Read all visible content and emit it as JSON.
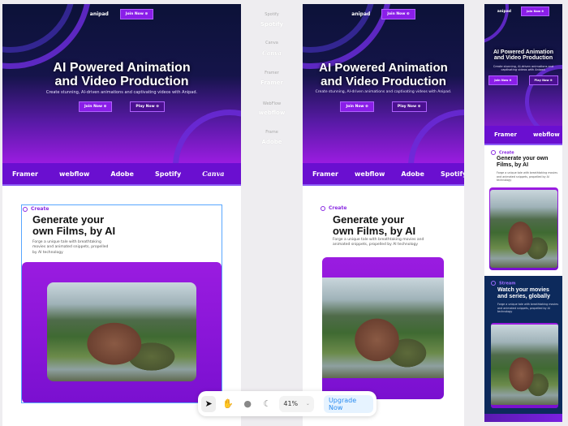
{
  "site": {
    "logo": "anipad",
    "join": "Join Now ⊕",
    "play": "Play Now ⊕",
    "title1": "AI Powered Animation",
    "title2": "and Video Production",
    "subtitle": "Create stunning, AI-driven animations and captivating videos with Anipad.",
    "brands": [
      "Framer",
      "webflow",
      "Adobe",
      "Spotify",
      "Canva"
    ],
    "create_tag": "Create",
    "create_title1": "Generate your",
    "create_title2": "own Films, by AI",
    "create_title_mobile": "Generate your own Films, by AI",
    "create_desc": "Forge a unique tale with breathtaking movies and animated snippets, propelled by AI technology",
    "stream_tag": "Stream",
    "stream_title": "Watch your movies and series, globally",
    "stream_desc": "Forge a unique tale with breathtaking movies and animated snippets, propelled by AI technology"
  },
  "side_logos": [
    {
      "label": "Spotify",
      "logo": "Spotify"
    },
    {
      "label": "Canva",
      "logo": "Canva"
    },
    {
      "label": "Framer",
      "logo": "Framer"
    },
    {
      "label": "WebFlow",
      "logo": "webflow"
    },
    {
      "label": "Frame",
      "logo": "Adobe"
    }
  ],
  "toolbar": {
    "zoom": "41%",
    "upgrade": "Upgrade Now"
  }
}
